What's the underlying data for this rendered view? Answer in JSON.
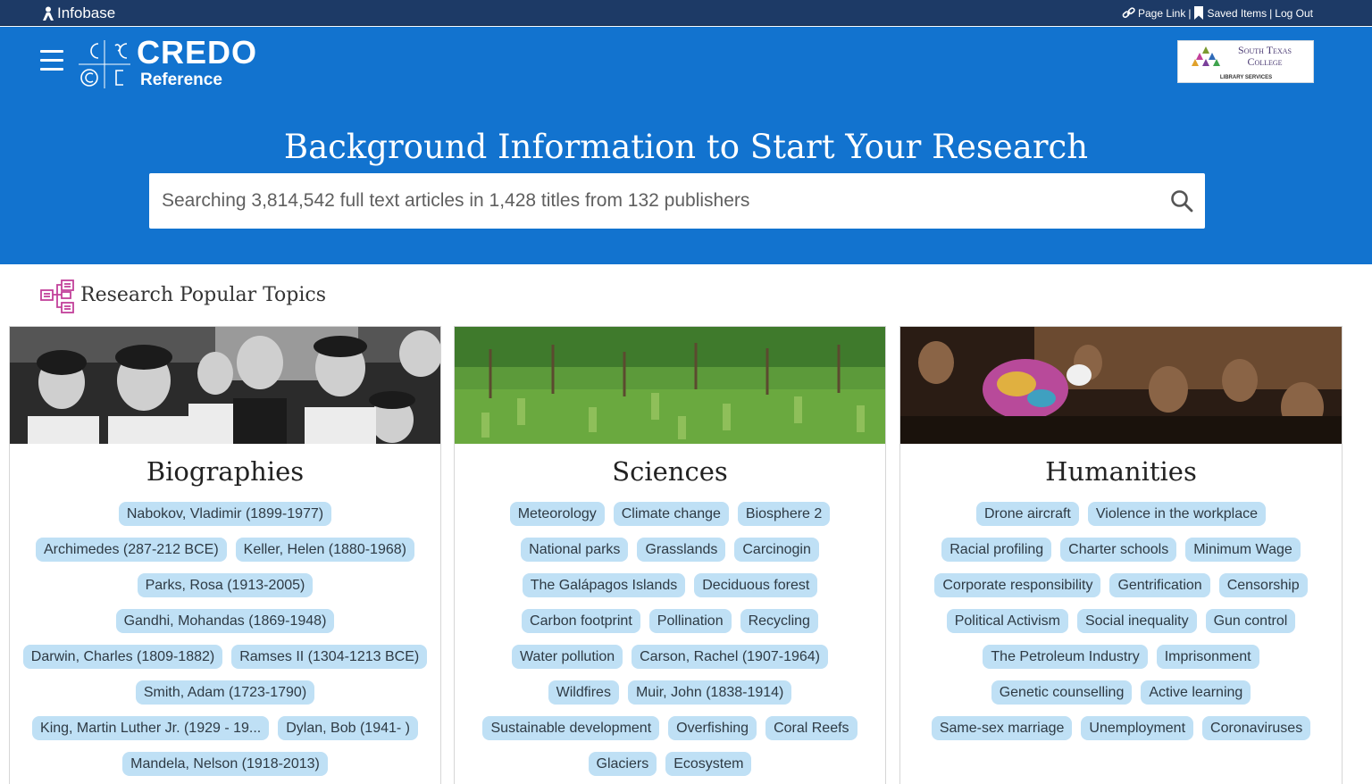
{
  "topbar": {
    "brand": "Infobase",
    "page_link": "Page Link",
    "saved_items": "Saved Items",
    "log_out": "Log Out",
    "separator": "|"
  },
  "header": {
    "logo_title": "CREDO",
    "logo_subtitle": "Reference",
    "institution_name_line1": "South Texas",
    "institution_name_line2": "College",
    "institution_tagline": "LIBRARY SERVICES"
  },
  "hero": {
    "title": "Background Information to Start Your Research",
    "search_placeholder": "Searching 3,814,542 full text articles in 1,428 titles from 132 publishers"
  },
  "popular": {
    "heading": "Research Popular Topics"
  },
  "cards": [
    {
      "title": "Biographies",
      "rows": [
        [
          "Nabokov, Vladimir (1899-1977)"
        ],
        [
          "Archimedes (287-212 BCE)",
          "Keller, Helen (1880-1968)"
        ],
        [
          "Parks, Rosa (1913-2005)"
        ],
        [
          "Gandhi, Mohandas (1869-1948)"
        ],
        [
          "Darwin, Charles (1809-1882)",
          "Ramses II (1304-1213 BCE)"
        ],
        [
          "Smith, Adam (1723-1790)"
        ],
        [
          "King, Martin Luther Jr. (1929 - 19...",
          "Dylan, Bob (1941- )"
        ],
        [
          "Mandela, Nelson (1918-2013)"
        ]
      ]
    },
    {
      "title": "Sciences",
      "rows": [
        [
          "Meteorology",
          "Climate change",
          "Biosphere 2"
        ],
        [
          "National parks",
          "Grasslands",
          "Carcinogin"
        ],
        [
          "The Galápagos Islands",
          "Deciduous forest"
        ],
        [
          "Carbon footprint",
          "Pollination",
          "Recycling"
        ],
        [
          "Water pollution",
          "Carson, Rachel (1907-1964)"
        ],
        [
          "Wildfires",
          "Muir, John (1838-1914)"
        ],
        [
          "Sustainable development",
          "Overfishing",
          "Coral Reefs"
        ],
        [
          "Glaciers",
          "Ecosystem"
        ]
      ]
    },
    {
      "title": "Humanities",
      "rows": [
        [
          "Drone aircraft",
          "Violence in the workplace"
        ],
        [
          "Racial profiling",
          "Charter schools",
          "Minimum Wage"
        ],
        [
          "Corporate responsibility",
          "Gentrification",
          "Censorship"
        ],
        [
          "Political Activism",
          "Social inequality",
          "Gun control"
        ],
        [
          "The Petroleum Industry",
          "Imprisonment"
        ],
        [
          "Genetic counselling",
          "Active learning"
        ],
        [
          "Same-sex marriage",
          "Unemployment",
          "Coronaviruses"
        ]
      ]
    }
  ],
  "colors": {
    "topbar": "#1d3a66",
    "hero": "#1273cf",
    "chip": "#bfe0f5",
    "icon_accent": "#c2409a"
  },
  "icons": [
    "person-icon",
    "menu-icon",
    "link-icon",
    "bookmark-icon",
    "search-icon",
    "topics-tree-icon"
  ]
}
